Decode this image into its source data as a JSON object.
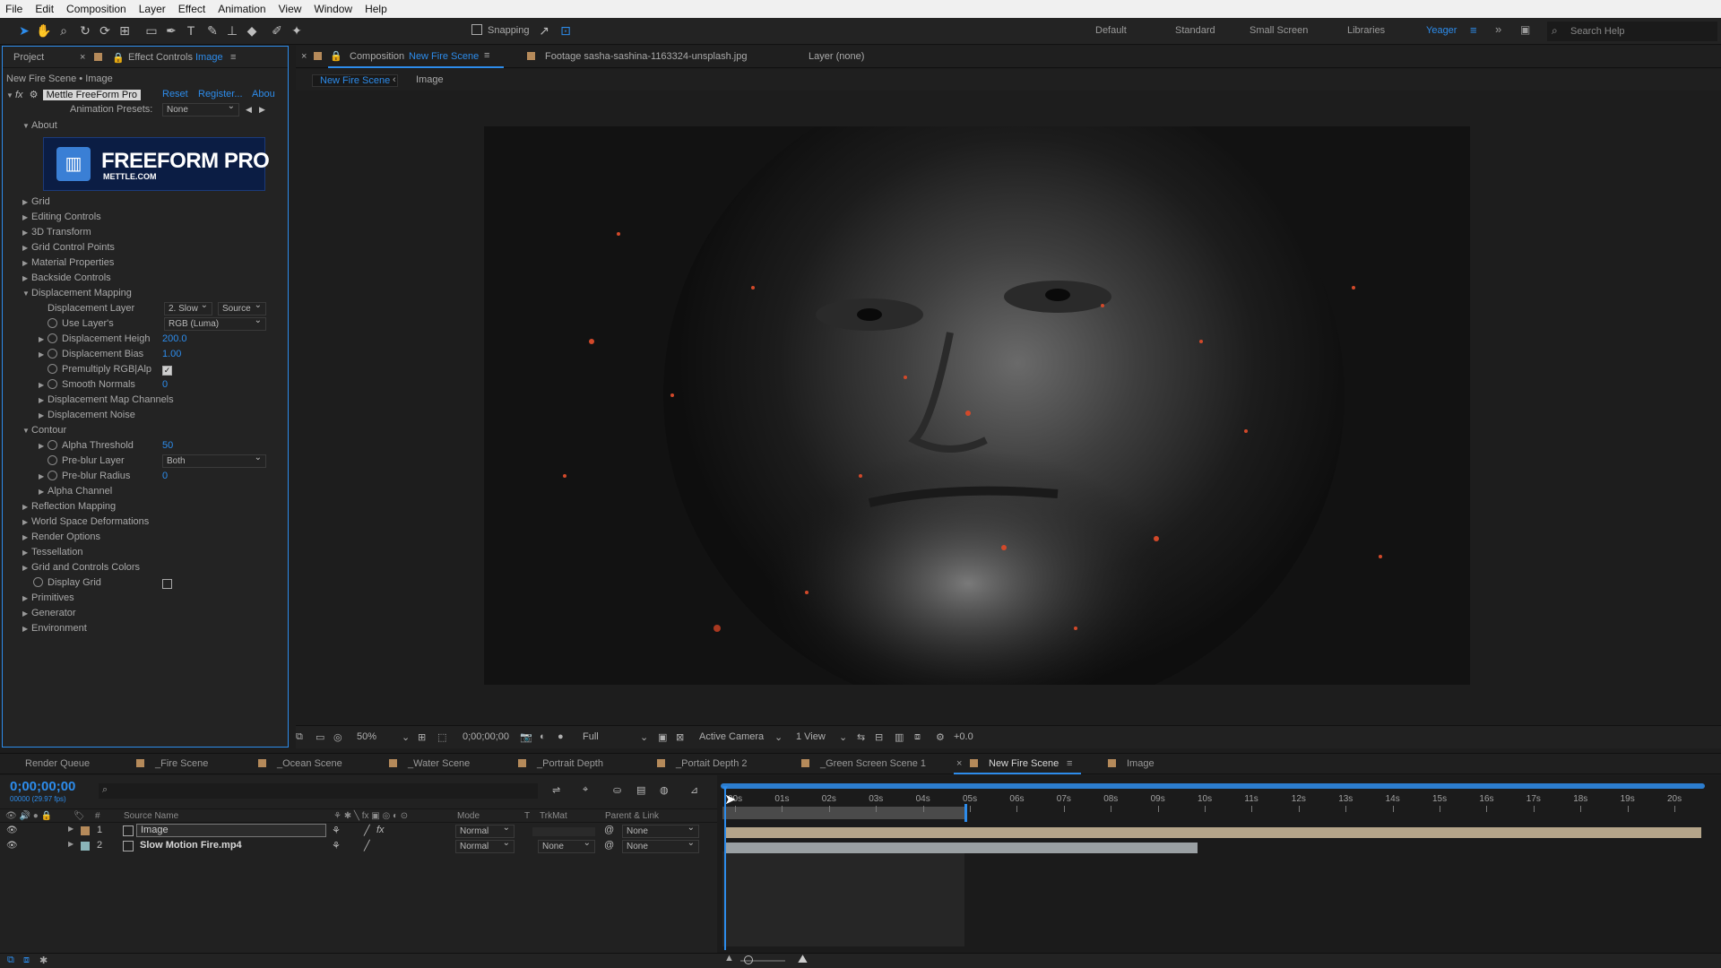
{
  "menu": [
    "File",
    "Edit",
    "Composition",
    "Layer",
    "Effect",
    "Animation",
    "View",
    "Window",
    "Help"
  ],
  "toolbar": {
    "snapping_label": "Snapping",
    "workspaces": [
      "Default",
      "Standard",
      "Small Screen",
      "Libraries",
      "Yeager"
    ],
    "active_workspace": "Yeager",
    "search_placeholder": "Search Help"
  },
  "left_panel": {
    "tab_project": "Project",
    "tab_effect_controls": "Effect Controls",
    "tab_effect_controls_target": "Image",
    "context_title": "New Fire Scene • Image",
    "effect_name": "Mettle FreeForm Pro",
    "reset_label": "Reset",
    "register_label": "Register...",
    "about_label": "Abou",
    "animation_presets_label": "Animation Presets:",
    "animation_presets_value": "None",
    "about_section": "About",
    "logo_text": "FREEFORM PRO",
    "logo_subtext": "METTLE.COM",
    "groups_top": [
      "Grid",
      "Editing Controls",
      "3D Transform",
      "Grid Control Points",
      "Material Properties",
      "Backside Controls"
    ],
    "displacement_mapping": {
      "label": "Displacement Mapping",
      "displacement_layer_label": "Displacement Layer",
      "displacement_layer_value": "2. Slow",
      "displacement_layer_source": "Source",
      "use_layers_label": "Use Layer's",
      "use_layers_value": "RGB (Luma)",
      "height_label": "Displacement Heigh",
      "height_value": "200.0",
      "bias_label": "Displacement Bias",
      "bias_value": "1.00",
      "premultiply_label": "Premultiply RGB|Alp",
      "premultiply_checked": true,
      "smooth_label": "Smooth Normals",
      "smooth_value": "0",
      "channels_label": "Displacement Map Channels",
      "noise_label": "Displacement Noise"
    },
    "contour": {
      "label": "Contour",
      "alpha_threshold_label": "Alpha Threshold",
      "alpha_threshold_value": "50",
      "preblur_layer_label": "Pre-blur Layer",
      "preblur_layer_value": "Both",
      "preblur_radius_label": "Pre-blur Radius",
      "preblur_radius_value": "0",
      "alpha_channel_label": "Alpha Channel"
    },
    "groups_mid": [
      "Reflection Mapping",
      "World Space Deformations",
      "Render Options",
      "Tessellation",
      "Grid and Controls Colors"
    ],
    "display_grid_label": "Display Grid",
    "display_grid_checked": false,
    "groups_bottom": [
      "Primitives",
      "Generator",
      "Environment"
    ]
  },
  "viewer": {
    "comp_tab_prefix": "Composition",
    "comp_tab_name": "New Fire Scene",
    "footage_tab": "Footage sasha-sashina-1163324-unsplash.jpg",
    "layer_tab": "Layer (none)",
    "subtab_active": "New Fire Scene",
    "subtab_other": "Image",
    "zoom": "50%",
    "timecode": "0;00;00;00",
    "resolution": "Full",
    "camera": "Active Camera",
    "view_count": "1 View",
    "exposure": "+0.0"
  },
  "timeline": {
    "tabs": [
      "Render Queue",
      "_Fire Scene",
      "_Ocean Scene",
      "_Water Scene",
      "_Portrait Depth",
      "_Portait Depth 2",
      "_Green Screen Scene 1",
      "New Fire Scene",
      "Image"
    ],
    "active_tab": "New Fire Scene",
    "tab_colors": [
      "#b58a5a",
      "#b58a5a",
      "#b58a5a",
      "#b58a5a",
      "#b58a5a",
      "#b58a5a",
      "#b58a5a",
      "#b58a5a"
    ],
    "timecode": "0;00;00;00",
    "timecode_sub": "00000 (29.97 fps)",
    "col_source_name": "Source Name",
    "col_mode": "Mode",
    "col_t": "T",
    "col_trkmat": "TrkMat",
    "col_parent": "Parent & Link",
    "layers": [
      {
        "num": "1",
        "name": "Image",
        "mode": "Normal",
        "trkmat": "",
        "parent": "None"
      },
      {
        "num": "2",
        "name": "Slow Motion Fire.mp4",
        "mode": "Normal",
        "trkmat": "None",
        "parent": "None"
      }
    ],
    "ruler": [
      "00s",
      "01s",
      "02s",
      "03s",
      "04s",
      "05s",
      "06s",
      "07s",
      "08s",
      "09s",
      "10s",
      "11s",
      "12s",
      "13s",
      "14s",
      "15s",
      "16s",
      "17s",
      "18s",
      "19s",
      "20s"
    ]
  },
  "colors": {
    "accent": "#2d8ceb",
    "layer1_bar": "#b5a58a",
    "layer2_bar": "#9aa0a3",
    "label_tan": "#b58a5a",
    "label_teal": "#8ab4b8"
  }
}
